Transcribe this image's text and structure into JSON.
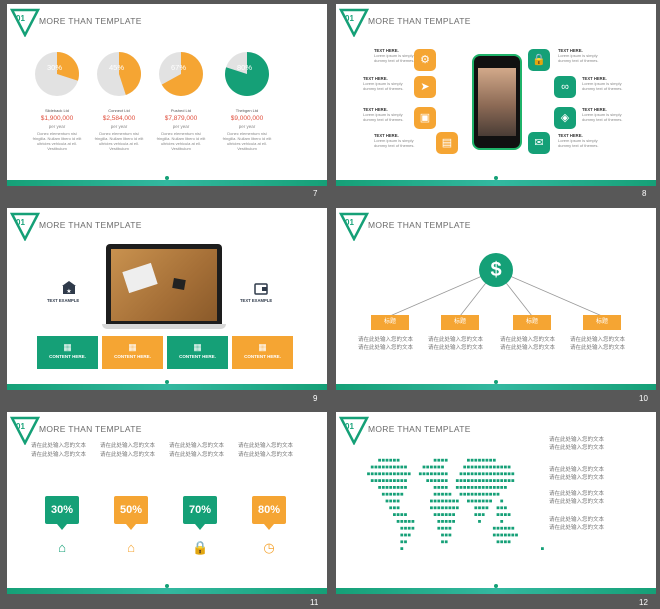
{
  "header_text": "MORE THAN TEMPLATE",
  "section_number": "01",
  "slides": {
    "s7": {
      "number": "7",
      "pies": [
        {
          "pct": "30%",
          "fraction": 0.3,
          "color": "#f5a533",
          "name": "Slideback Ltd",
          "value": "$1,900,000",
          "per": "per year"
        },
        {
          "pct": "45%",
          "fraction": 0.45,
          "color": "#f5a533",
          "name": "Connect Ltd",
          "value": "$2,584,000",
          "per": "per year"
        },
        {
          "pct": "67%",
          "fraction": 0.67,
          "color": "#f5a533",
          "name": "Pushed Ltd",
          "value": "$7,879,000",
          "per": "per year"
        },
        {
          "pct": "80%",
          "fraction": 0.8,
          "color": "#15a077",
          "name": "Thebgen Ltd",
          "value": "$9,000,000",
          "per": "per year"
        }
      ],
      "desc": "Donec elementum nisi fringilla. Nullam libero id elit ultricies vehicula at ell. Vestibulum"
    },
    "s8": {
      "number": "8",
      "left_items": [
        {
          "title": "TEXT HERE.",
          "body": "Lorem ipsum is simply dummy text of themes."
        },
        {
          "title": "TEXT HERE.",
          "body": "Lorem ipsum is simply dummy text of themes."
        },
        {
          "title": "TEXT HERE.",
          "body": "Lorem ipsum is simply dummy text of themes."
        },
        {
          "title": "TEXT HERE.",
          "body": "Lorem ipsum is simply dummy text of themes."
        }
      ],
      "right_items": [
        {
          "title": "TEXT HERE.",
          "body": "Lorem ipsum is simply dummy text of themes."
        },
        {
          "title": "TEXT HERE.",
          "body": "Lorem ipsum is simply dummy text of themes."
        },
        {
          "title": "TEXT HERE.",
          "body": "Lorem ipsum is simply dummy text of themes."
        },
        {
          "title": "TEXT HERE.",
          "body": "Lorem ipsum is simply dummy text of themes."
        }
      ]
    },
    "s9": {
      "number": "9",
      "text_left": "TEXT EXAMPLE",
      "text_right": "TEXT EXAMPLE",
      "boxes": [
        {
          "label": "CONTENT HERE.",
          "color": "#15a077"
        },
        {
          "label": "CONTENT HERE.",
          "color": "#f5a533"
        },
        {
          "label": "CONTENT HERE.",
          "color": "#15a077"
        },
        {
          "label": "CONTENT HERE.",
          "color": "#f5a533"
        }
      ]
    },
    "s10": {
      "number": "10",
      "root_symbol": "$",
      "nodes": [
        {
          "label": "标题",
          "line1": "请在此处输入您的文本",
          "line2": "请在此处输入您的文本"
        },
        {
          "label": "标题",
          "line1": "请在此处输入您的文本",
          "line2": "请在此处输入您的文本"
        },
        {
          "label": "标题",
          "line1": "请在此处输入您的文本",
          "line2": "请在此处输入您的文本"
        },
        {
          "label": "标题",
          "line1": "请在此处输入您的文本",
          "line2": "请在此处输入您的文本"
        }
      ]
    },
    "s11": {
      "number": "11",
      "cols": [
        {
          "line1": "请在此处输入您的文本",
          "line2": "请在此处输入您的文本",
          "pct": "30%",
          "color": "#15a077",
          "icon": "house-icon"
        },
        {
          "line1": "请在此处输入您的文本",
          "line2": "请在此处输入您的文本",
          "pct": "50%",
          "color": "#f5a533",
          "icon": "home-icon"
        },
        {
          "line1": "请在此处输入您的文本",
          "line2": "请在此处输入您的文本",
          "pct": "70%",
          "color": "#15a077",
          "icon": "lock-icon"
        },
        {
          "line1": "请在此处输入您的文本",
          "line2": "请在此处输入您的文本",
          "pct": "80%",
          "color": "#f5a533",
          "icon": "clock-icon"
        }
      ]
    },
    "s12": {
      "number": "12",
      "lines": [
        "请在此处输入您的文本",
        "请在此处输入您的文本",
        "请在此处输入您的文本",
        "请在此处输入您的文本",
        "请在此处输入您的文本",
        "请在此处输入您的文本",
        "请在此处输入您的文本",
        "请在此处输入您的文本"
      ]
    }
  }
}
